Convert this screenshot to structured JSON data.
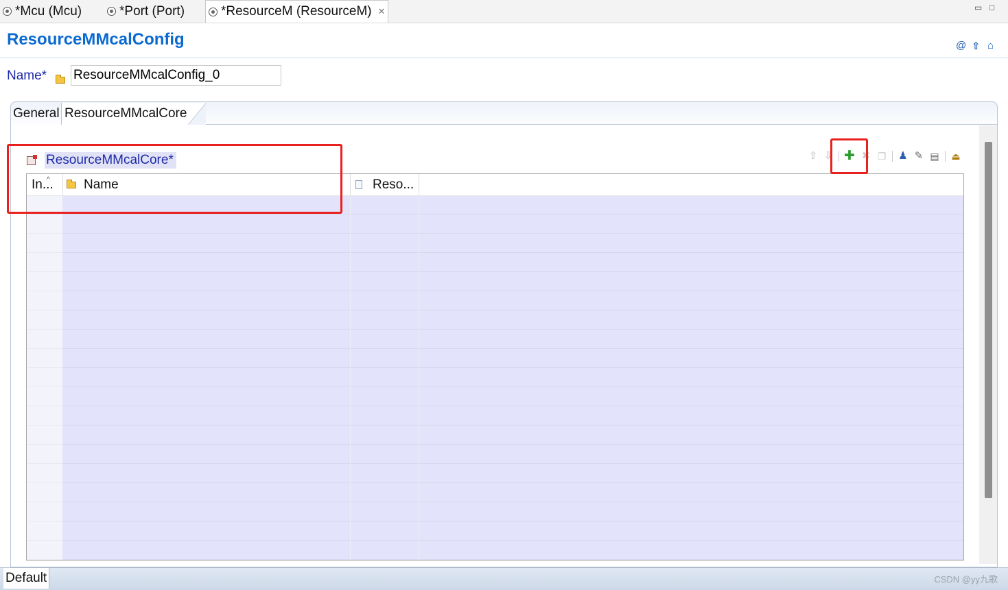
{
  "editor_tabs": [
    {
      "label": "*Mcu (Mcu)",
      "active": false
    },
    {
      "label": "*Port (Port)",
      "active": false
    },
    {
      "label": "*ResourceM (ResourceM)",
      "active": true
    }
  ],
  "window_controls": {
    "minimize": "▭",
    "maximize": "□"
  },
  "form": {
    "title": "ResourceMMcalConfig",
    "header_icons": [
      "at-icon",
      "up-arrow-icon",
      "home-icon"
    ],
    "name_label": "Name*",
    "name_value": "ResourceMMcalConfig_0"
  },
  "page_tabs": [
    "General",
    "ResourceMMcalCore"
  ],
  "section": {
    "title": "ResourceMMcalCore*"
  },
  "toolbar": {
    "items": [
      "move-up-icon",
      "move-down-icon",
      "add-icon",
      "delete-icon",
      "copy-icon",
      "user-add-icon",
      "edit-icon",
      "form-icon",
      "import-icon"
    ],
    "add_symbol": "✚",
    "delete_symbol": "✖",
    "up_symbol": "⇧",
    "down_symbol": "⇩"
  },
  "table": {
    "columns": [
      "In...",
      "Name",
      "Reso..."
    ],
    "rows": []
  },
  "bottom_tabs": [
    "Default"
  ],
  "watermark": "CSDN @yy九歌",
  "colors": {
    "accent": "#0b6ad1",
    "label": "#1c2aa8",
    "highlight": "#e8201e",
    "row": "#e3e3fc"
  }
}
